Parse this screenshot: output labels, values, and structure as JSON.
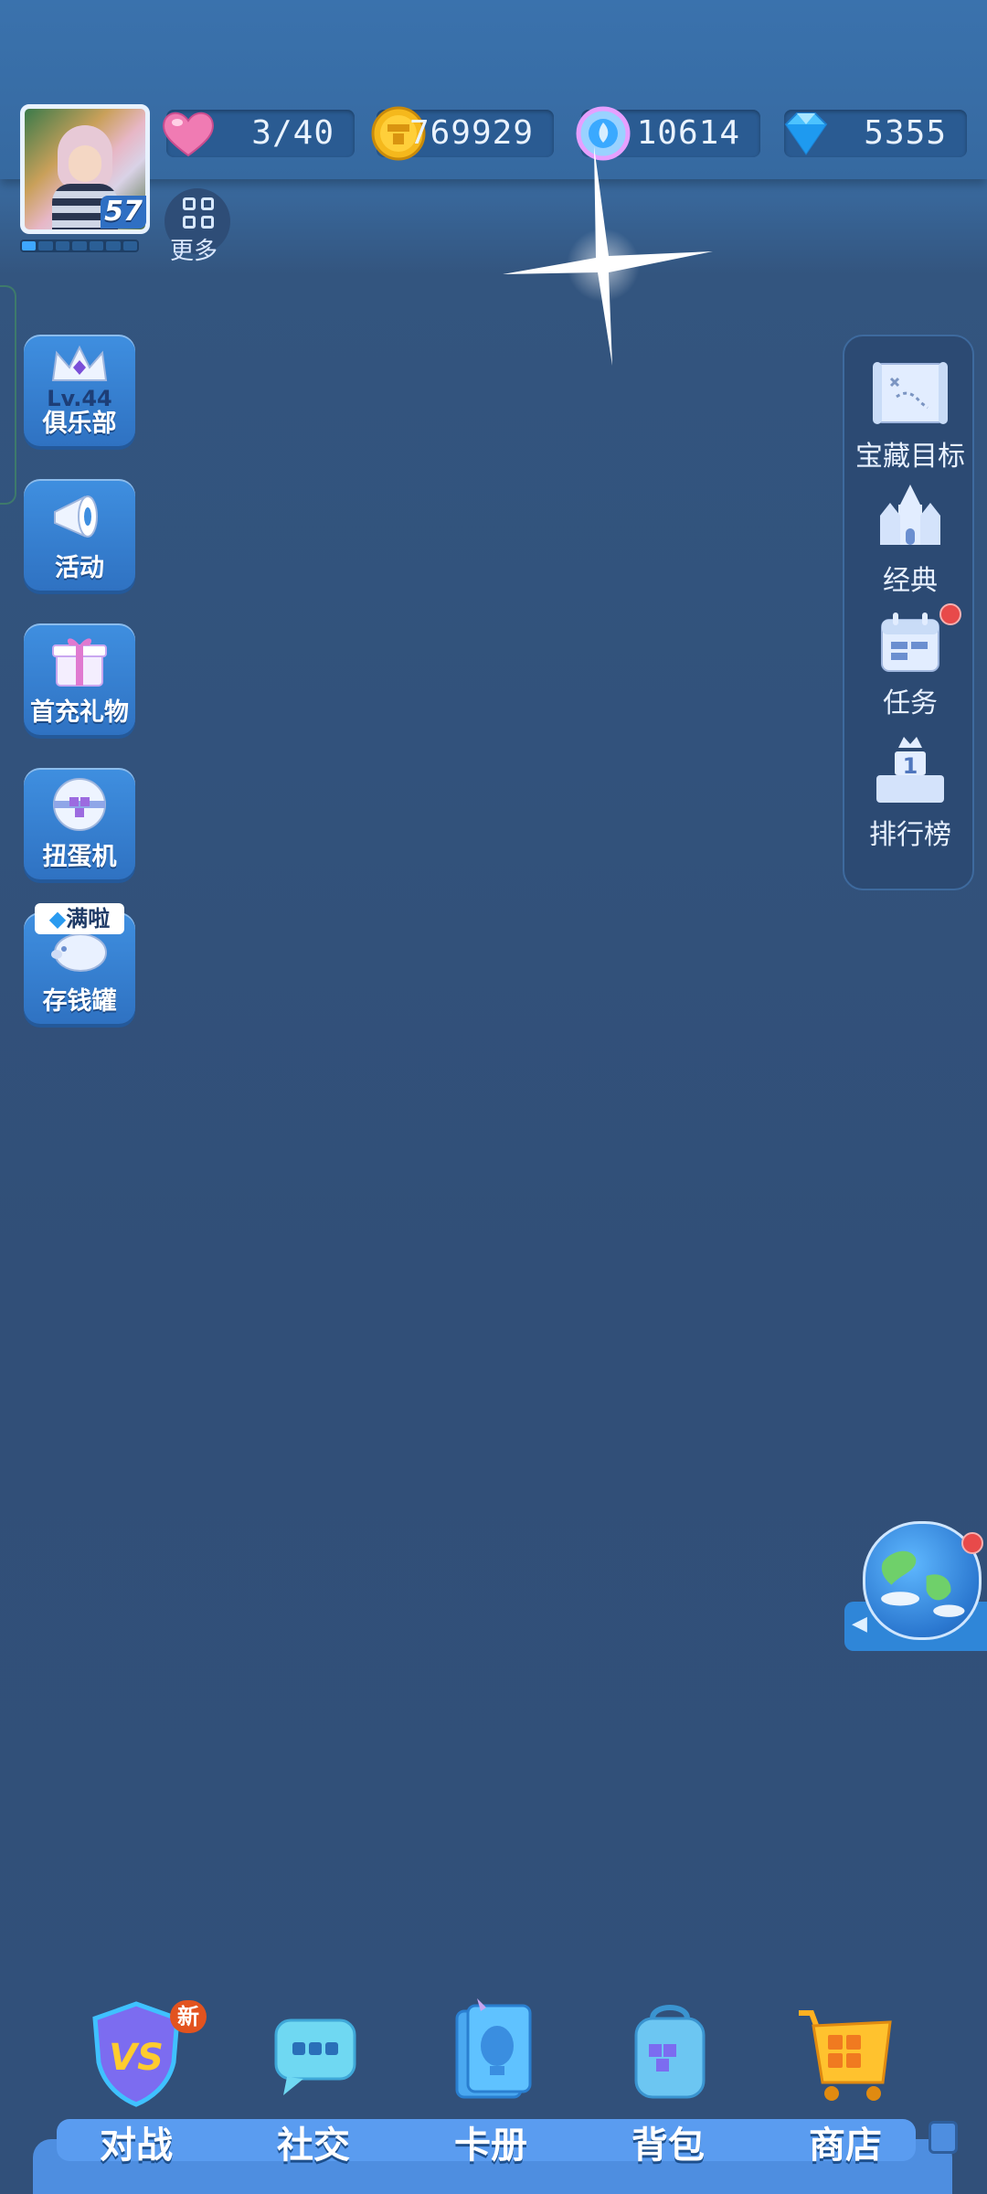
{
  "player": {
    "level": "57",
    "xp_segments_filled": 1,
    "xp_segments_total": 7
  },
  "resources": {
    "hearts": "3/40",
    "coins": "769929",
    "energy": "10614",
    "diamonds": "5355"
  },
  "top_buttons": {
    "more_label": "更多"
  },
  "left_menu": {
    "club_level": "Lv.44",
    "club_label": "俱乐部",
    "activity_label": "活动",
    "first_recharge_label": "首充礼物",
    "gacha_label": "扭蛋机",
    "piggy_bank_label": "存钱罐",
    "piggy_full_tag": "满啦"
  },
  "right_menu": {
    "treasure_label": "宝藏目标",
    "classic_label": "经典",
    "tasks_label": "任务",
    "ranking_label": "排行榜",
    "ranking_icon_text": "1"
  },
  "bottom_nav": {
    "items": [
      {
        "label": "对战",
        "badge": "新"
      },
      {
        "label": "社交"
      },
      {
        "label": "卡册"
      },
      {
        "label": "背包"
      },
      {
        "label": "商店"
      }
    ],
    "vs_text": "VS"
  },
  "colors": {
    "accent": "#3f8fe0",
    "badge_red": "#e84a4a",
    "new_badge": "#e2531f"
  }
}
